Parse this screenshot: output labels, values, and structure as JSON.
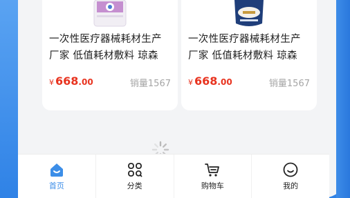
{
  "products": [
    {
      "title_line1": "一次性医疗器械耗材生产",
      "title_line2": "厂家 低值耗材敷料 琼森",
      "price_symbol": "¥",
      "price_int": "668",
      "price_dec": ".00",
      "sales": "销量1567",
      "image_icon": "bottle-product-image"
    },
    {
      "title_line1": "一次性医疗器械耗材生产",
      "title_line2": "厂家 低值耗材敷料 琼森",
      "price_symbol": "¥",
      "price_int": "668",
      "price_dec": ".00",
      "sales": "销量1567",
      "image_icon": "pouch-product-image"
    }
  ],
  "tabbar": {
    "home": "首页",
    "category": "分类",
    "cart": "购物车",
    "mine": "我的",
    "active": "home"
  },
  "colors": {
    "accent": "#3c8ee8",
    "price": "#e8331f",
    "frame": "#2f82e6"
  }
}
